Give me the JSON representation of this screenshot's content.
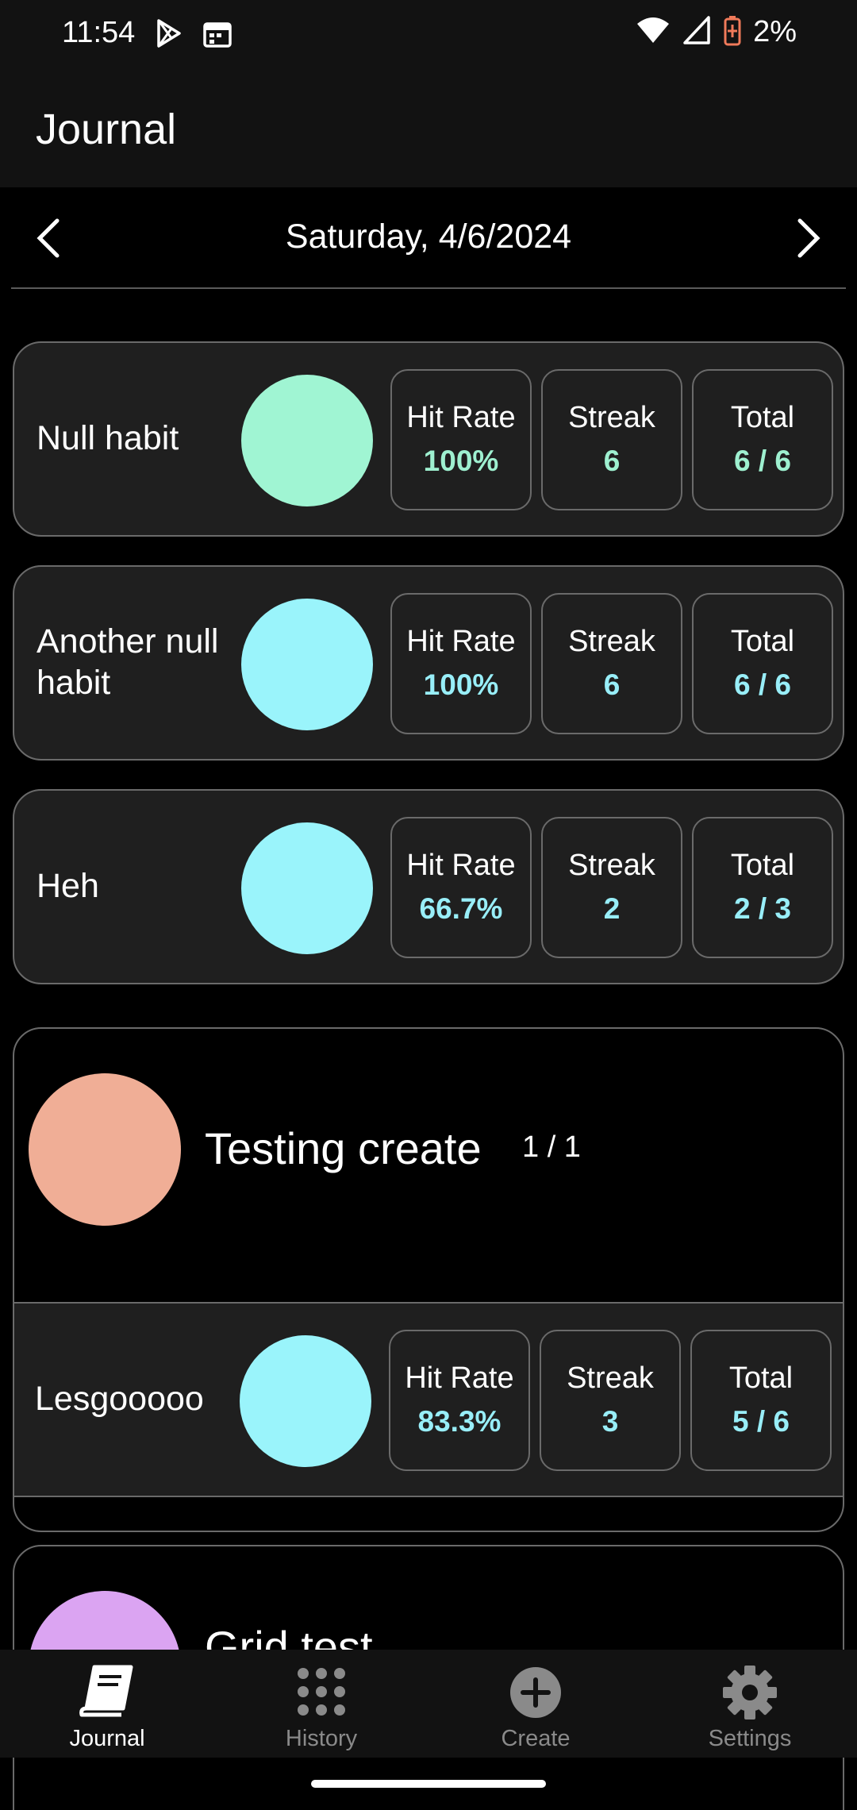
{
  "status": {
    "time": "11:54",
    "battery": "2%"
  },
  "app": {
    "title": "Journal"
  },
  "date": {
    "text": "Saturday, 4/6/2024"
  },
  "habits": [
    {
      "name": "Null habit",
      "color": "#a0f5d3",
      "hit_rate_label": "Hit Rate",
      "hit_rate": "100%",
      "streak_label": "Streak",
      "streak": "6",
      "total_label": "Total",
      "total": "6 / 6",
      "value_color": "#9ef0d0"
    },
    {
      "name": "Another null habit",
      "color": "#9af4fb",
      "hit_rate_label": "Hit Rate",
      "hit_rate": "100%",
      "streak_label": "Streak",
      "streak": "6",
      "total_label": "Total",
      "total": "6 / 6",
      "value_color": "#98eef8"
    },
    {
      "name": "Heh",
      "color": "#9af4fb",
      "hit_rate_label": "Hit Rate",
      "hit_rate": "66.7%",
      "streak_label": "Streak",
      "streak": "2",
      "total_label": "Total",
      "total": "2 / 3",
      "value_color": "#98eef8"
    }
  ],
  "groups": [
    {
      "title": "Testing create",
      "count": "1 / 1",
      "color": "#f0ae96",
      "habit": {
        "name": "Lesgooooo",
        "color": "#9af4fb",
        "hit_rate_label": "Hit Rate",
        "hit_rate": "83.3%",
        "streak_label": "Streak",
        "streak": "3",
        "total_label": "Total",
        "total": "5 / 6",
        "value_color": "#98eef8"
      }
    },
    {
      "title": "Grid test",
      "color": "#dba4f2"
    }
  ],
  "nav": {
    "items": [
      {
        "label": "Journal",
        "icon": "book-icon",
        "active": true
      },
      {
        "label": "History",
        "icon": "grid-dots-icon",
        "active": false
      },
      {
        "label": "Create",
        "icon": "plus-circle-icon",
        "active": false
      },
      {
        "label": "Settings",
        "icon": "gear-icon",
        "active": false
      }
    ],
    "active_color": "#ffffff",
    "inactive_color": "#8a8a8a"
  }
}
